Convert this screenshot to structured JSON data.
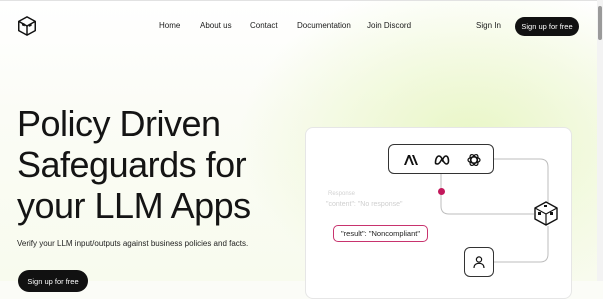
{
  "nav": {
    "links": [
      "Home",
      "About us",
      "Contact",
      "Documentation",
      "Join Discord"
    ],
    "sign_in": "Sign In",
    "sign_up": "Sign up for free"
  },
  "hero": {
    "title_lines": [
      "Policy Driven",
      "Safeguards for",
      "your LLM Apps"
    ],
    "subtitle": "Verify your LLM input/outputs against business policies and facts.",
    "cta": "Sign up for free"
  },
  "demo": {
    "providers": [
      "anthropic-icon",
      "meta-icon",
      "openai-icon"
    ],
    "faded_label": "Response",
    "faded_line": "\"content\": \"No response\"",
    "result_text": "\"result\": \"Noncompliant\"",
    "accent_color": "#c2185b",
    "user_icon": "user-icon"
  }
}
